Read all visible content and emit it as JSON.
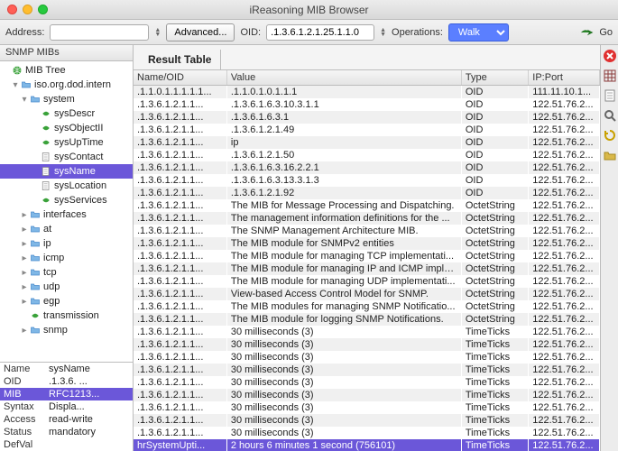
{
  "window": {
    "title": "iReasoning MIB Browser"
  },
  "toolbar": {
    "address_label": "Address:",
    "address_value": "",
    "advanced_label": "Advanced...",
    "oid_label": "OID:",
    "oid_value": ".1.3.6.1.2.1.25.1.1.0",
    "ops_label": "Operations:",
    "ops_value": "Walk",
    "go_label": "Go"
  },
  "left": {
    "header": "SNMP MIBs",
    "tree": [
      {
        "indent": 0,
        "twisty": "",
        "icon": "globe",
        "label": "MIB Tree"
      },
      {
        "indent": 1,
        "twisty": "▾",
        "icon": "folder",
        "label": "iso.org.dod.intern"
      },
      {
        "indent": 2,
        "twisty": "▾",
        "icon": "folder",
        "label": "system"
      },
      {
        "indent": 3,
        "twisty": "",
        "icon": "leaf",
        "label": "sysDescr"
      },
      {
        "indent": 3,
        "twisty": "",
        "icon": "leaf",
        "label": "sysObjectII"
      },
      {
        "indent": 3,
        "twisty": "",
        "icon": "leaf",
        "label": "sysUpTime"
      },
      {
        "indent": 3,
        "twisty": "",
        "icon": "doc",
        "label": "sysContact"
      },
      {
        "indent": 3,
        "twisty": "",
        "icon": "doc",
        "label": "sysName",
        "selected": true
      },
      {
        "indent": 3,
        "twisty": "",
        "icon": "doc",
        "label": "sysLocation"
      },
      {
        "indent": 3,
        "twisty": "",
        "icon": "leaf",
        "label": "sysServices"
      },
      {
        "indent": 2,
        "twisty": "▸",
        "icon": "folder",
        "label": "interfaces"
      },
      {
        "indent": 2,
        "twisty": "▸",
        "icon": "folder",
        "label": "at"
      },
      {
        "indent": 2,
        "twisty": "▸",
        "icon": "folder",
        "label": "ip"
      },
      {
        "indent": 2,
        "twisty": "▸",
        "icon": "folder",
        "label": "icmp"
      },
      {
        "indent": 2,
        "twisty": "▸",
        "icon": "folder",
        "label": "tcp"
      },
      {
        "indent": 2,
        "twisty": "▸",
        "icon": "folder",
        "label": "udp"
      },
      {
        "indent": 2,
        "twisty": "▸",
        "icon": "folder",
        "label": "egp"
      },
      {
        "indent": 2,
        "twisty": "",
        "icon": "leaf",
        "label": "transmission"
      },
      {
        "indent": 2,
        "twisty": "▸",
        "icon": "folder",
        "label": "snmp"
      }
    ],
    "props": [
      {
        "k": "Name",
        "v": "sysName"
      },
      {
        "k": "OID",
        "v": ".1.3.6. ..."
      },
      {
        "k": "MIB",
        "v": "RFC1213...",
        "selected": true
      },
      {
        "k": "Syntax",
        "v": "Displa..."
      },
      {
        "k": "Access",
        "v": "read-write"
      },
      {
        "k": "Status",
        "v": "mandatory"
      },
      {
        "k": "DefVal",
        "v": ""
      }
    ]
  },
  "right": {
    "tab": "Result Table",
    "columns": [
      "Name/OID",
      "Value",
      "Type",
      "IP:Port"
    ],
    "rows": [
      {
        "n": ".1.1.0.1.1.1.1.1...",
        "v": ".1.1.0.1.0.1.1.1",
        "t": "OID",
        "ip": "111.11.10.1..."
      },
      {
        "n": ".1.3.6.1.2.1.1...",
        "v": ".1.3.6.1.6.3.10.3.1.1",
        "t": "OID",
        "ip": "122.51.76.2..."
      },
      {
        "n": ".1.3.6.1.2.1.1...",
        "v": ".1.3.6.1.6.3.1",
        "t": "OID",
        "ip": "122.51.76.2..."
      },
      {
        "n": ".1.3.6.1.2.1.1...",
        "v": ".1.3.6.1.2.1.49",
        "t": "OID",
        "ip": "122.51.76.2..."
      },
      {
        "n": ".1.3.6.1.2.1.1...",
        "v": "ip",
        "t": "OID",
        "ip": "122.51.76.2..."
      },
      {
        "n": ".1.3.6.1.2.1.1...",
        "v": ".1.3.6.1.2.1.50",
        "t": "OID",
        "ip": "122.51.76.2..."
      },
      {
        "n": ".1.3.6.1.2.1.1...",
        "v": ".1.3.6.1.6.3.16.2.2.1",
        "t": "OID",
        "ip": "122.51.76.2..."
      },
      {
        "n": ".1.3.6.1.2.1.1...",
        "v": ".1.3.6.1.6.3.13.3.1.3",
        "t": "OID",
        "ip": "122.51.76.2..."
      },
      {
        "n": ".1.3.6.1.2.1.1...",
        "v": ".1.3.6.1.2.1.92",
        "t": "OID",
        "ip": "122.51.76.2..."
      },
      {
        "n": ".1.3.6.1.2.1.1...",
        "v": "The MIB for Message Processing and Dispatching.",
        "t": "OctetString",
        "ip": "122.51.76.2..."
      },
      {
        "n": ".1.3.6.1.2.1.1...",
        "v": "The management information definitions for the ...",
        "t": "OctetString",
        "ip": "122.51.76.2..."
      },
      {
        "n": ".1.3.6.1.2.1.1...",
        "v": "The SNMP Management Architecture MIB.",
        "t": "OctetString",
        "ip": "122.51.76.2..."
      },
      {
        "n": ".1.3.6.1.2.1.1...",
        "v": "The MIB module for SNMPv2 entities",
        "t": "OctetString",
        "ip": "122.51.76.2..."
      },
      {
        "n": ".1.3.6.1.2.1.1...",
        "v": "The MIB module for managing TCP implementati...",
        "t": "OctetString",
        "ip": "122.51.76.2..."
      },
      {
        "n": ".1.3.6.1.2.1.1...",
        "v": "The MIB module for managing IP and ICMP imple...",
        "t": "OctetString",
        "ip": "122.51.76.2..."
      },
      {
        "n": ".1.3.6.1.2.1.1...",
        "v": "The MIB module for managing UDP implementati...",
        "t": "OctetString",
        "ip": "122.51.76.2..."
      },
      {
        "n": ".1.3.6.1.2.1.1...",
        "v": "View-based Access Control Model for SNMP.",
        "t": "OctetString",
        "ip": "122.51.76.2..."
      },
      {
        "n": ".1.3.6.1.2.1.1...",
        "v": "The MIB modules for managing SNMP Notificatio...",
        "t": "OctetString",
        "ip": "122.51.76.2..."
      },
      {
        "n": ".1.3.6.1.2.1.1...",
        "v": "The MIB module for logging SNMP Notifications.",
        "t": "OctetString",
        "ip": "122.51.76.2..."
      },
      {
        "n": ".1.3.6.1.2.1.1...",
        "v": "30 milliseconds (3)",
        "t": "TimeTicks",
        "ip": "122.51.76.2..."
      },
      {
        "n": ".1.3.6.1.2.1.1...",
        "v": "30 milliseconds (3)",
        "t": "TimeTicks",
        "ip": "122.51.76.2..."
      },
      {
        "n": ".1.3.6.1.2.1.1...",
        "v": "30 milliseconds (3)",
        "t": "TimeTicks",
        "ip": "122.51.76.2..."
      },
      {
        "n": ".1.3.6.1.2.1.1...",
        "v": "30 milliseconds (3)",
        "t": "TimeTicks",
        "ip": "122.51.76.2..."
      },
      {
        "n": ".1.3.6.1.2.1.1...",
        "v": "30 milliseconds (3)",
        "t": "TimeTicks",
        "ip": "122.51.76.2..."
      },
      {
        "n": ".1.3.6.1.2.1.1...",
        "v": "30 milliseconds (3)",
        "t": "TimeTicks",
        "ip": "122.51.76.2..."
      },
      {
        "n": ".1.3.6.1.2.1.1...",
        "v": "30 milliseconds (3)",
        "t": "TimeTicks",
        "ip": "122.51.76.2..."
      },
      {
        "n": ".1.3.6.1.2.1.1...",
        "v": "30 milliseconds (3)",
        "t": "TimeTicks",
        "ip": "122.51.76.2..."
      },
      {
        "n": ".1.3.6.1.2.1.1...",
        "v": "30 milliseconds (3)",
        "t": "TimeTicks",
        "ip": "122.51.76.2..."
      },
      {
        "n": "hrSystemUpti...",
        "v": "2 hours 6 minutes 1 second (756101)",
        "t": "TimeTicks",
        "ip": "122.51.76.2...",
        "selected": true
      }
    ]
  }
}
